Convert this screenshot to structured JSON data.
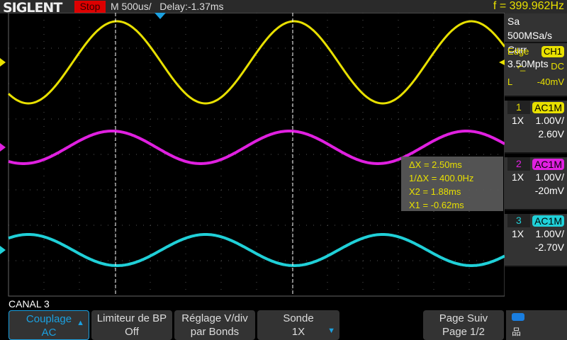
{
  "header": {
    "brand": "SIGLENT",
    "run_state": "Stop",
    "timebase": "M 500us/",
    "delay": "Delay:-1.37ms",
    "frequency": "f = 399.962Hz"
  },
  "acquisition": {
    "sample_rate": "Sa 500MSa/s",
    "memory": "Curr 3.50Mpts"
  },
  "trigger": {
    "type": "Edge",
    "source": "CH1",
    "slope_icon": "falling-edge-icon",
    "coupling": "DC",
    "level_label": "L",
    "level": "-40mV"
  },
  "channels": [
    {
      "num": "1",
      "coupling": "AC1M",
      "probe": "1X",
      "scale": "1.00V/",
      "offset": "2.60V",
      "color": "#e8e000"
    },
    {
      "num": "2",
      "coupling": "AC1M",
      "probe": "1X",
      "scale": "1.00V/",
      "offset": "-20mV",
      "color": "#e020e0"
    },
    {
      "num": "3",
      "coupling": "AC1M",
      "probe": "1X",
      "scale": "1.00V/",
      "offset": "-2.70V",
      "color": "#20d0d8"
    }
  ],
  "cursors": {
    "dx": "ΔX = 2.50ms",
    "inv_dx": "1/ΔX = 400.0Hz",
    "x2": "X2 = 1.88ms",
    "x1": "X1 = -0.62ms"
  },
  "menu": {
    "title": "CANAL 3",
    "buttons": [
      {
        "line1": "Couplage",
        "line2": "AC"
      },
      {
        "line1": "Limiteur de BP",
        "line2": "Off"
      },
      {
        "line1": "Réglage V/div",
        "line2": "par Bonds"
      },
      {
        "line1": "Sonde",
        "line2": "1X"
      },
      {
        "line1": "Page Suiv",
        "line2": "Page 1/2"
      }
    ]
  }
}
